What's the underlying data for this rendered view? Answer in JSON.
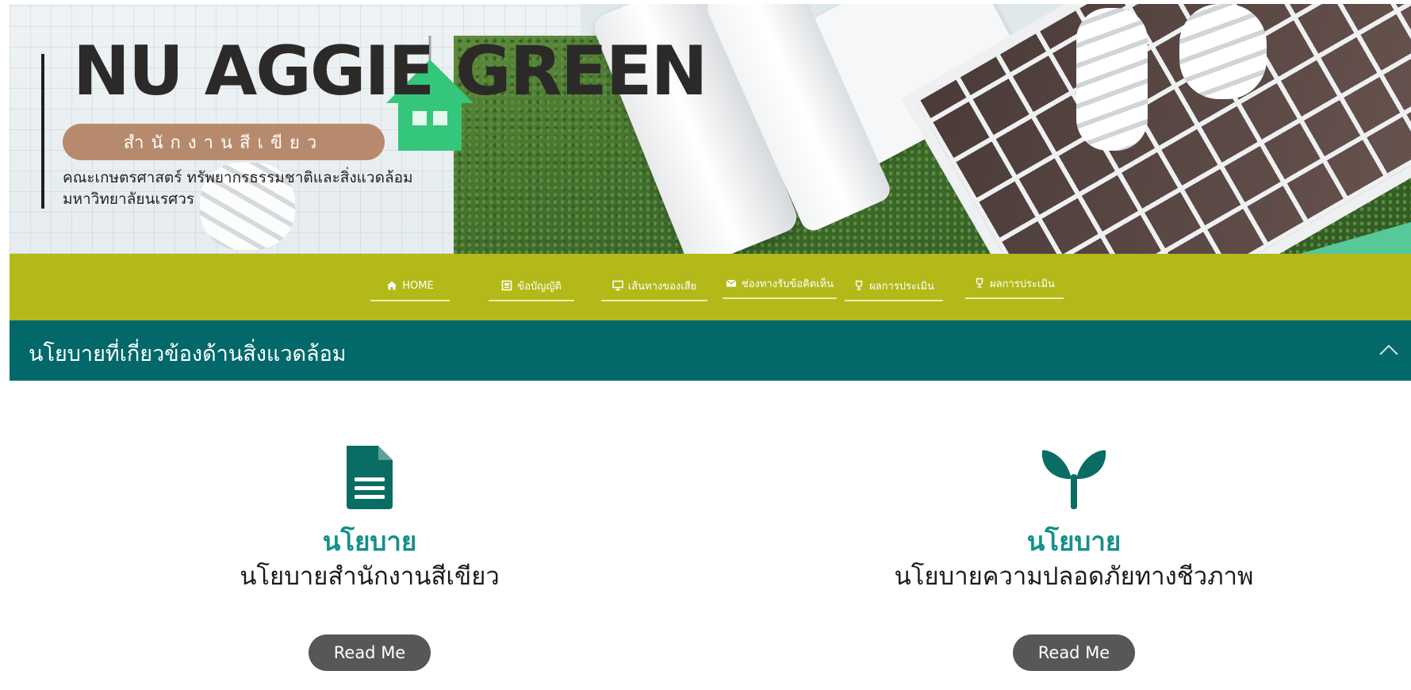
{
  "hero": {
    "title": "NU AGGIE GREEN",
    "badge": "สำนักงานสีเขียว",
    "subtitle_line1": "คณะเกษตรศาสตร์ ทรัพยากรธรรมชาติและสิ่งแวดล้อม",
    "subtitle_line2": "มหาวิทยาลัยนเรศวร"
  },
  "nav": {
    "items": [
      {
        "label": "HOME",
        "icon": "home-icon"
      },
      {
        "label": "ข้อบัญญัติ",
        "icon": "book-icon"
      },
      {
        "label": "เส้นทางของเสีย",
        "icon": "monitor-icon"
      },
      {
        "label": "ช่องทางรับข้อคิดเห็น",
        "icon": "envelope-icon"
      },
      {
        "label": "ผลการประเมิน",
        "icon": "trophy-icon"
      },
      {
        "label": "ผลการประเมิน",
        "icon": "trophy-icon"
      }
    ]
  },
  "section": {
    "title": "นโยบายที่เกี่ยวข้องด้านสิ่งแวดล้อม",
    "toggle_icon": "chevron-up-icon"
  },
  "cards": [
    {
      "icon": "document-icon",
      "heading": "นโยบาย",
      "text": "นโยบายสำนักงานสีเขียว",
      "button": "Read Me"
    },
    {
      "icon": "sprout-icon",
      "heading": "นโยบาย",
      "text": "นโยบายความปลอดภัยทางชีวภาพ",
      "button": "Read Me"
    }
  ],
  "colors": {
    "nav_bg": "#b2b919",
    "section_bar": "#02686a",
    "accent_teal": "#14908a",
    "badge": "#b88a6d",
    "button": "#575757"
  }
}
